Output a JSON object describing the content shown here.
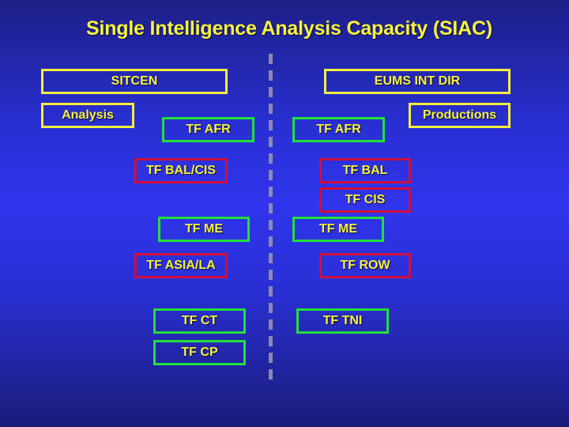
{
  "title": "Single Intelligence Analysis Capacity (SIAC)",
  "colors": {
    "text": "#f7f23a",
    "header_border": "#f4ef3e",
    "green_border": "#22e03c",
    "red_border": "#d0103a",
    "background": "#2a2fd4"
  },
  "left": {
    "header": "SITCEN",
    "subheader": "Analysis",
    "boxes": [
      {
        "label": "TF AFR",
        "color": "green"
      },
      {
        "label": "TF BAL/CIS",
        "color": "red"
      },
      {
        "label": "TF ME",
        "color": "green"
      },
      {
        "label": "TF ASIA/LA",
        "color": "red"
      },
      {
        "label": "TF CT",
        "color": "green"
      },
      {
        "label": "TF CP",
        "color": "green"
      }
    ]
  },
  "right": {
    "header": "EUMS INT DIR",
    "subheader": "Productions",
    "boxes": [
      {
        "label": "TF AFR",
        "color": "green"
      },
      {
        "label": "TF BAL",
        "color": "red"
      },
      {
        "label": "TF CIS",
        "color": "red"
      },
      {
        "label": "TF ME",
        "color": "green"
      },
      {
        "label": "TF ROW",
        "color": "red"
      },
      {
        "label": "TF TNI",
        "color": "green"
      }
    ]
  }
}
